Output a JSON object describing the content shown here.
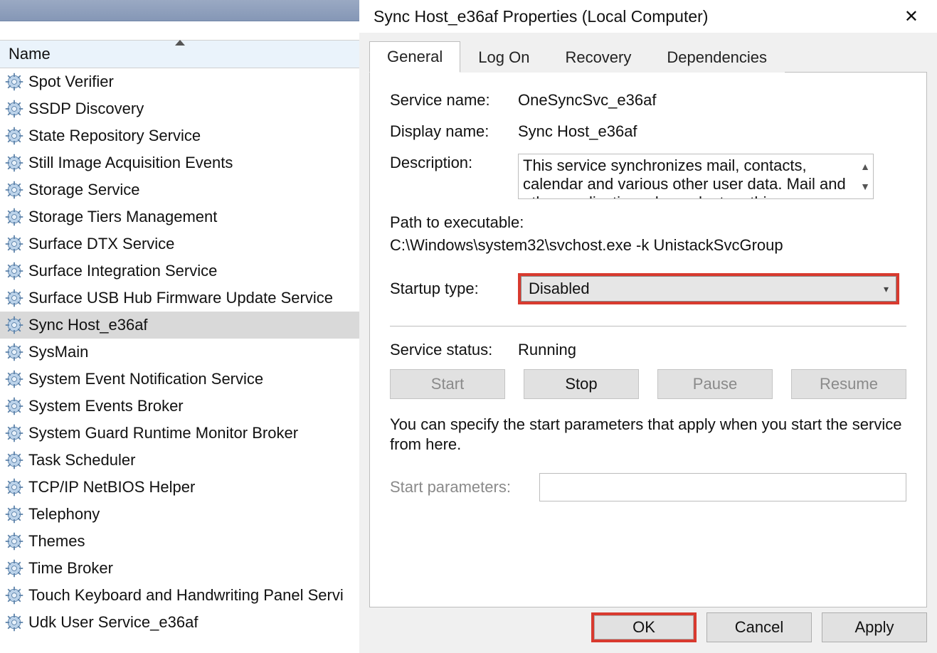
{
  "services_header": "Name",
  "services": [
    "Spot Verifier",
    "SSDP Discovery",
    "State Repository Service",
    "Still Image Acquisition Events",
    "Storage Service",
    "Storage Tiers Management",
    "Surface DTX Service",
    "Surface Integration Service",
    "Surface USB Hub Firmware Update Service",
    "Sync Host_e36af",
    "SysMain",
    "System Event Notification Service",
    "System Events Broker",
    "System Guard Runtime Monitor Broker",
    "Task Scheduler",
    "TCP/IP NetBIOS Helper",
    "Telephony",
    "Themes",
    "Time Broker",
    "Touch Keyboard and Handwriting Panel Servi",
    "Udk User Service_e36af"
  ],
  "selected_service_index": 9,
  "dialog": {
    "title": "Sync Host_e36af Properties (Local Computer)",
    "tabs": {
      "general": "General",
      "logon": "Log On",
      "recovery": "Recovery",
      "dependencies": "Dependencies"
    },
    "labels": {
      "service_name": "Service name:",
      "display_name": "Display name:",
      "description": "Description:",
      "path": "Path to executable:",
      "startup": "Startup type:",
      "status": "Service status:",
      "note": "You can specify the start parameters that apply when you start the service from here.",
      "params": "Start parameters:"
    },
    "service_name": "OneSyncSvc_e36af",
    "display_name": "Sync Host_e36af",
    "description": "This service synchronizes mail, contacts, calendar and various other user data. Mail and other applications dependent on this functionality will not",
    "path": "C:\\Windows\\system32\\svchost.exe -k UnistackSvcGroup",
    "startup_type": "Disabled",
    "status": "Running",
    "buttons": {
      "start": "Start",
      "stop": "Stop",
      "pause": "Pause",
      "resume": "Resume"
    },
    "footer": {
      "ok": "OK",
      "cancel": "Cancel",
      "apply": "Apply"
    },
    "start_parameters": ""
  }
}
